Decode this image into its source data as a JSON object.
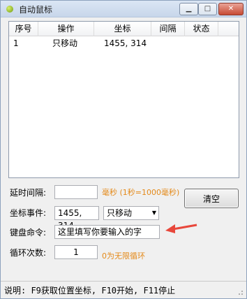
{
  "window": {
    "title": "自动鼠标",
    "minimize_glyph": "▁",
    "maximize_glyph": "□",
    "close_glyph": "✕"
  },
  "table": {
    "columns": [
      "序号",
      "操作",
      "坐标",
      "间隔",
      "状态"
    ],
    "rows": [
      {
        "index": "1",
        "action": "只移动",
        "coord": "1455, 314",
        "interval": "",
        "status": ""
      }
    ]
  },
  "form": {
    "delay_label": "延时间隔:",
    "delay_value": "",
    "delay_hint": "毫秒 (1秒=1000毫秒)",
    "coord_label": "坐标事件:",
    "coord_value": "1455, 314",
    "action_selected": "只移动",
    "key_label": "键盘命令:",
    "key_value": "这里填写你要输入的字",
    "loop_label": "循环次数:",
    "loop_value": "1",
    "loop_hint": "0为无限循环",
    "clear_label": "清空"
  },
  "status": {
    "text": "说明: F9获取位置坐标, F10开始, F11停止"
  },
  "colors": {
    "hint": "#e48a1a",
    "arrow": "#e8473b"
  },
  "icons": [
    "app-icon",
    "chevron-down-icon",
    "arrow-icon",
    "resize-grip-icon"
  ]
}
